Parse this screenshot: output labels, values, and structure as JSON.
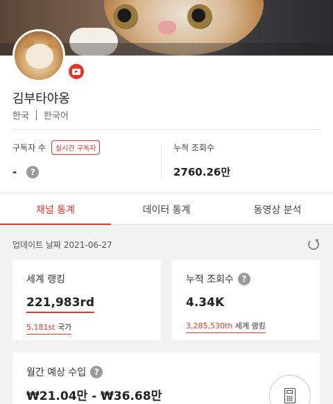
{
  "channel": {
    "name": "김부타야옹",
    "country": "한국",
    "language": "한국어",
    "platform_icon": "youtube-icon"
  },
  "stats": {
    "subscribers_label": "구독자 수",
    "live_label": "실시간 구독자",
    "subscribers_value": "-",
    "total_views_label": "누적 조회수",
    "total_views_value": "2760.26만"
  },
  "tabs": [
    {
      "label": "채널 통계",
      "active": true
    },
    {
      "label": "데이터 통계",
      "active": false
    },
    {
      "label": "동영상 분석",
      "active": false
    }
  ],
  "update": {
    "label": "업데이트 날짜 2021-06-27"
  },
  "cards": {
    "world_rank": {
      "label": "세계 랭킹",
      "value": "221,983rd",
      "sub_value": "5,181st",
      "sub_label": "국가"
    },
    "views": {
      "label": "누적 조회수",
      "value": "4.34K",
      "sub_value": "3,285,530th",
      "sub_label": "세계 랭킹"
    },
    "revenue": {
      "label": "월간 예상 수입",
      "value": "₩21.04만 - ₩36.68만"
    }
  },
  "colors": {
    "accent": "#e5352b",
    "background": "#f2f2f3"
  },
  "help_glyph": "?"
}
